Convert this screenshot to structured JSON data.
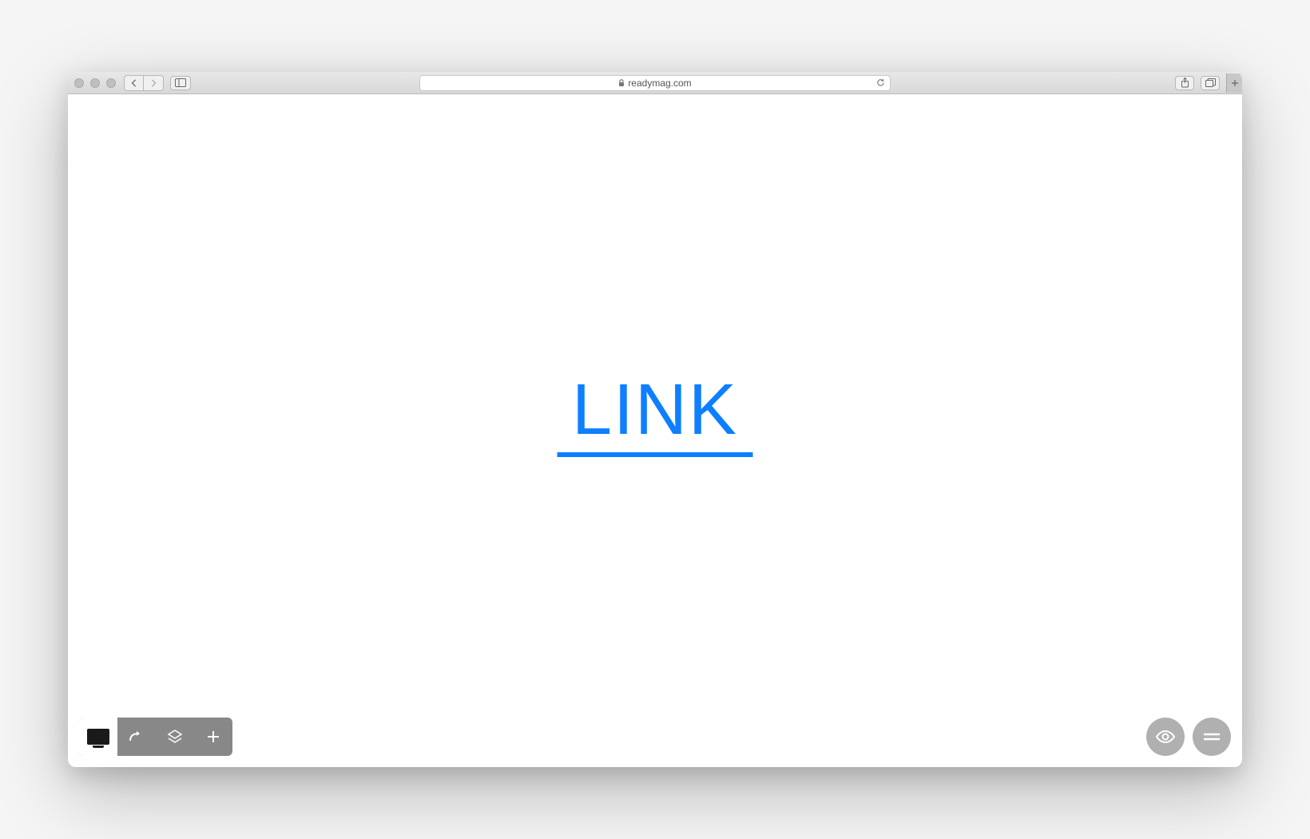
{
  "browser": {
    "url": "readymag.com"
  },
  "page": {
    "link_text": "LINK"
  }
}
